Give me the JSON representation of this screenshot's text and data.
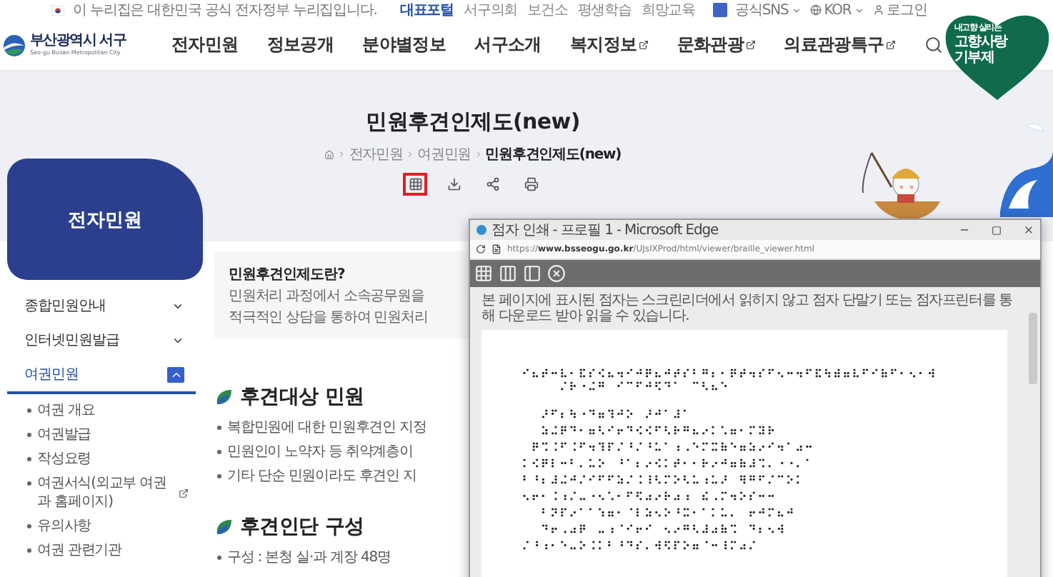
{
  "top_bar": {
    "notice": "이 누리집은 대한민국 공식 전자정부 누리집입니다.",
    "links": [
      {
        "label": "대표포털",
        "selected": true
      },
      {
        "label": "서구의회",
        "selected": false
      },
      {
        "label": "보건소",
        "selected": false
      },
      {
        "label": "평생학습",
        "selected": false
      },
      {
        "label": "희망교육",
        "selected": false
      }
    ],
    "sns": "공식SNS",
    "language": "KOR",
    "login": "로그인"
  },
  "header": {
    "logo_name": "부산광역시 서구",
    "logo_sub": "Seo-gu Busan Metropolitan City",
    "menu": [
      {
        "label": "전자민원",
        "external": false
      },
      {
        "label": "정보공개",
        "external": false
      },
      {
        "label": "분야별정보",
        "external": false
      },
      {
        "label": "서구소개",
        "external": false
      },
      {
        "label": "복지정보",
        "external": true
      },
      {
        "label": "문화관광",
        "external": true
      },
      {
        "label": "의료관광특구",
        "external": true
      }
    ],
    "banner": {
      "line_1": "내고향 살리는",
      "line_2": "고향사랑",
      "line_3": "기부제"
    }
  },
  "page": {
    "title": "민원후견인제도(new)",
    "breadcrumb": [
      "전자민원",
      "여권민원",
      "민원후견인제도(new)"
    ],
    "tools": [
      {
        "kind": "braille",
        "selected": true
      },
      {
        "kind": "download",
        "selected": false
      },
      {
        "kind": "share",
        "selected": false
      },
      {
        "kind": "print",
        "selected": false
      }
    ]
  },
  "sidebar": {
    "title": "전자민원",
    "items": [
      {
        "label": "종합민원안내",
        "expanded": false
      },
      {
        "label": "인터넷민원발급",
        "expanded": false
      },
      {
        "label": "여권민원",
        "expanded": true,
        "children": [
          {
            "label": "여권 개요",
            "external": false
          },
          {
            "label": "여권발급",
            "external": false
          },
          {
            "label": "작성요령",
            "external": false
          },
          {
            "label": "여권서식(외교부 여권과 홈페이지)",
            "external": true
          },
          {
            "label": "유의사항",
            "external": false
          },
          {
            "label": "여권 관련기관",
            "external": false
          }
        ]
      }
    ]
  },
  "content": {
    "intro": {
      "title": "민원후견인제도란?",
      "lines": [
        "민원처리 과정에서 소속공무원을",
        "적극적인 상담을 통하여 민원처리"
      ]
    },
    "sections": [
      {
        "heading": "후견대상 민원",
        "bullets": [
          "복합민원에 대한 민원후견인 지정",
          "민원인이 노약자 등 취약계층이",
          "기타 단순 민원이라도 후견인 지"
        ]
      },
      {
        "heading": "후견인단 구성",
        "bullets": [
          "구성 : 본청 실·과 계장 48명"
        ]
      }
    ]
  },
  "popup": {
    "title": "점자 인쇄 - 프로필 1 - Microsoft Edge",
    "url": "https://**www.bsseogu.go.kr**/UJsIXProd/html/viewer/braille_viewer.html",
    "notice": "본 페이지에 표시된 점자는 스크린리더에서 읽히지 않고 점자 단말기 또는 점자프린터를 통해 다운로드 받아 읽을 수 있습니다."
  }
}
